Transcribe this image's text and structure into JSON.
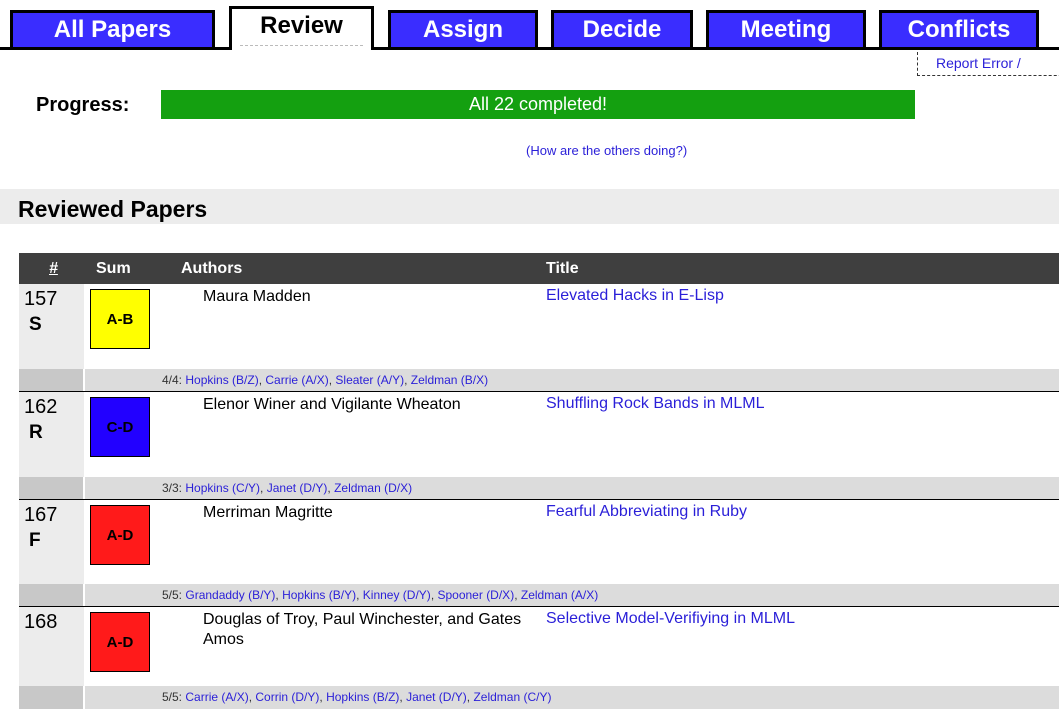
{
  "tabs": [
    {
      "label": "All Papers",
      "active": false
    },
    {
      "label": "Review",
      "active": true
    },
    {
      "label": "Assign",
      "active": false
    },
    {
      "label": "Decide",
      "active": false
    },
    {
      "label": "Meeting",
      "active": false
    },
    {
      "label": "Conflicts",
      "active": false
    }
  ],
  "report_error": "Report Error /",
  "progress": {
    "label": "Progress:",
    "text": "All 22 completed!",
    "fraction": 1.0,
    "color": "#14a010"
  },
  "others_link": "(How are the others doing?)",
  "section_title": "Reviewed Papers",
  "table": {
    "headers": {
      "num": "#",
      "sum": "Sum",
      "authors": "Authors",
      "title": "Title"
    },
    "rows": [
      {
        "id": "157",
        "decision": "S",
        "sum": "A-B",
        "sum_color": "#ffff00",
        "authors": "Maura Madden",
        "title": "Elevated Hacks in E-Lisp",
        "review_count": "4/4:",
        "reviews": [
          "Hopkins (B/Z)",
          "Carrie (A/X)",
          "Sleater (A/Y)",
          "Zeldman (B/X)"
        ]
      },
      {
        "id": "162",
        "decision": "R",
        "sum": "C-D",
        "sum_color": "#2200ff",
        "authors": "Elenor Winer and Vigilante Wheaton",
        "title": "Shuffling Rock Bands in MLML",
        "review_count": "3/3:",
        "reviews": [
          "Hopkins (C/Y)",
          "Janet (D/Y)",
          "Zeldman (D/X)"
        ]
      },
      {
        "id": "167",
        "decision": "F",
        "sum": "A-D",
        "sum_color": "#ff1a1a",
        "authors": "Merriman Magritte",
        "title": "Fearful Abbreviating in Ruby",
        "review_count": "5/5:",
        "reviews": [
          "Grandaddy (B/Y)",
          "Hopkins (B/Y)",
          "Kinney (D/Y)",
          "Spooner (D/X)",
          "Zeldman (A/X)"
        ]
      },
      {
        "id": "168",
        "decision": "",
        "sum": "A-D",
        "sum_color": "#ff1a1a",
        "authors": "Douglas of Troy, Paul Winchester, and Gates Amos",
        "title": "Selective Model-Verifiying in MLML",
        "review_count": "5/5:",
        "reviews": [
          "Carrie (A/X)",
          "Corrin (D/Y)",
          "Hopkins (B/Z)",
          "Janet (D/Y)",
          "Zeldman (C/Y)"
        ]
      }
    ]
  }
}
